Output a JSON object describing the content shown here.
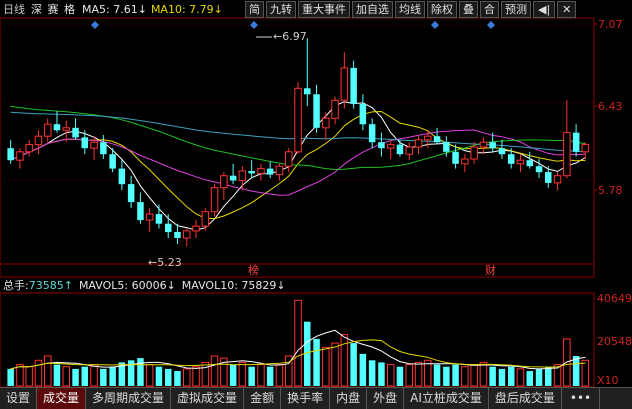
{
  "header": {
    "period": "日线",
    "stock_name": "深 赛 格",
    "ma5_label": "MA5: 7.61",
    "ma10_label": "MA10: 7.79",
    "arrow_down": "↓",
    "toolbar": {
      "jian": "简",
      "jiuzhuan": "九转",
      "events": "重大事件",
      "add_watch": "加自选",
      "junxian": "均线",
      "chuquan": "除权",
      "overlay": "叠",
      "zoom": "合",
      "predict": "预测",
      "back_icon": "◀|",
      "close_icon": "✕"
    }
  },
  "price_panel": {
    "y_labels": [
      "7.07",
      "6.43",
      "5.78"
    ],
    "high_label": "6.97",
    "low_label": "5.23",
    "marker_bang": "榜",
    "marker_cai": "财"
  },
  "volume_panel": {
    "label": "总手:",
    "value": "73585",
    "mavol5_label": "MAVOL5: 60006",
    "mavol10_label": "MAVOL10: 75829",
    "y_labels": [
      "40649",
      "20548",
      "X10"
    ]
  },
  "tabs": [
    "设置",
    "成交量",
    "多周期成交量",
    "虚拟成交量",
    "金额",
    "换手率",
    "内盘",
    "外盘",
    "AI立桩成交量",
    "盘后成交量",
    "•••"
  ],
  "active_tab": 1,
  "chart_data": {
    "type": "candlestick",
    "price_range": [
      5.23,
      6.97
    ],
    "candles": [
      [
        6.05,
        6.12,
        5.92,
        5.95
      ],
      [
        5.95,
        6.05,
        5.88,
        6.02
      ],
      [
        6.02,
        6.12,
        5.98,
        6.08
      ],
      [
        6.08,
        6.2,
        6.0,
        6.15
      ],
      [
        6.15,
        6.3,
        6.1,
        6.25
      ],
      [
        6.25,
        6.36,
        6.18,
        6.2
      ],
      [
        6.2,
        6.28,
        6.1,
        6.22
      ],
      [
        6.22,
        6.3,
        6.12,
        6.14
      ],
      [
        6.14,
        6.2,
        6.0,
        6.05
      ],
      [
        6.05,
        6.15,
        5.95,
        6.1
      ],
      [
        6.1,
        6.16,
        5.96,
        6.0
      ],
      [
        6.0,
        6.05,
        5.85,
        5.88
      ],
      [
        5.88,
        5.95,
        5.7,
        5.75
      ],
      [
        5.75,
        5.82,
        5.55,
        5.6
      ],
      [
        5.6,
        5.68,
        5.42,
        5.45
      ],
      [
        5.45,
        5.55,
        5.35,
        5.5
      ],
      [
        5.5,
        5.58,
        5.38,
        5.42
      ],
      [
        5.42,
        5.5,
        5.3,
        5.35
      ],
      [
        5.35,
        5.42,
        5.25,
        5.3
      ],
      [
        5.3,
        5.38,
        5.23,
        5.36
      ],
      [
        5.36,
        5.45,
        5.3,
        5.4
      ],
      [
        5.4,
        5.55,
        5.36,
        5.52
      ],
      [
        5.52,
        5.75,
        5.48,
        5.72
      ],
      [
        5.72,
        5.85,
        5.62,
        5.82
      ],
      [
        5.82,
        5.92,
        5.75,
        5.78
      ],
      [
        5.78,
        5.9,
        5.7,
        5.86
      ],
      [
        5.86,
        5.95,
        5.8,
        5.84
      ],
      [
        5.84,
        5.92,
        5.78,
        5.88
      ],
      [
        5.88,
        5.94,
        5.8,
        5.83
      ],
      [
        5.83,
        5.92,
        5.78,
        5.9
      ],
      [
        5.9,
        6.05,
        5.85,
        6.02
      ],
      [
        6.02,
        6.6,
        6.0,
        6.55
      ],
      [
        6.55,
        6.97,
        6.4,
        6.5
      ],
      [
        6.5,
        6.58,
        6.18,
        6.22
      ],
      [
        6.22,
        6.35,
        6.12,
        6.3
      ],
      [
        6.3,
        6.48,
        6.25,
        6.45
      ],
      [
        6.45,
        6.85,
        6.38,
        6.72
      ],
      [
        6.72,
        6.78,
        6.38,
        6.42
      ],
      [
        6.42,
        6.5,
        6.2,
        6.25
      ],
      [
        6.25,
        6.3,
        6.05,
        6.1
      ],
      [
        6.1,
        6.18,
        5.98,
        6.05
      ],
      [
        6.05,
        6.12,
        5.96,
        6.08
      ],
      [
        6.08,
        6.12,
        5.98,
        6.0
      ],
      [
        6.0,
        6.1,
        5.95,
        6.06
      ],
      [
        6.06,
        6.15,
        6.0,
        6.12
      ],
      [
        6.12,
        6.2,
        6.05,
        6.15
      ],
      [
        6.15,
        6.22,
        6.08,
        6.1
      ],
      [
        6.1,
        6.15,
        5.98,
        6.02
      ],
      [
        6.02,
        6.08,
        5.88,
        5.92
      ],
      [
        5.92,
        6.0,
        5.85,
        5.96
      ],
      [
        5.96,
        6.1,
        5.92,
        6.06
      ],
      [
        6.06,
        6.14,
        6.0,
        6.1
      ],
      [
        6.1,
        6.18,
        6.02,
        6.05
      ],
      [
        6.05,
        6.12,
        5.96,
        6.0
      ],
      [
        6.0,
        6.05,
        5.88,
        5.92
      ],
      [
        5.92,
        6.0,
        5.85,
        5.95
      ],
      [
        5.95,
        6.02,
        5.88,
        5.9
      ],
      [
        5.9,
        5.96,
        5.8,
        5.85
      ],
      [
        5.85,
        5.9,
        5.72,
        5.76
      ],
      [
        5.76,
        5.85,
        5.7,
        5.82
      ],
      [
        5.82,
        6.45,
        5.8,
        6.18
      ],
      [
        6.18,
        6.25,
        5.98,
        6.02
      ],
      [
        6.02,
        6.1,
        5.96,
        6.08
      ]
    ],
    "volumes": [
      8,
      10,
      9,
      12,
      14,
      10,
      9,
      8,
      9,
      10,
      8,
      9,
      11,
      12,
      13,
      10,
      9,
      8,
      7,
      8,
      9,
      11,
      14,
      13,
      10,
      11,
      9,
      10,
      9,
      10,
      14,
      40,
      30,
      22,
      18,
      20,
      24,
      20,
      15,
      12,
      11,
      10,
      9,
      10,
      11,
      12,
      10,
      9,
      10,
      9,
      10,
      11,
      9,
      8,
      9,
      8,
      7,
      8,
      9,
      10,
      22,
      14,
      12
    ],
    "ma_series": [
      {
        "name": "MA5",
        "color": "#ffffff"
      },
      {
        "name": "MA10",
        "color": "#e6d800"
      },
      {
        "name": "MA20",
        "color": "#e040e0"
      },
      {
        "name": "MA30",
        "color": "#20c020"
      },
      {
        "name": "MA60",
        "color": "#40a0c0"
      }
    ]
  }
}
